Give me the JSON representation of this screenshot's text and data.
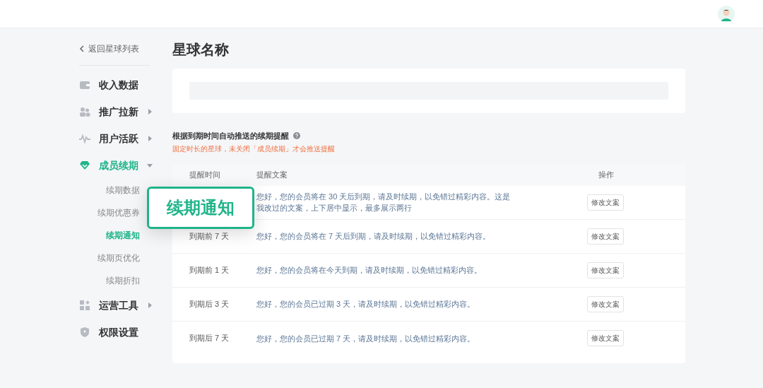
{
  "back_link": "返回星球列表",
  "sidebar": {
    "items": [
      {
        "label": "收入数据",
        "kind": "wallet",
        "selected": false
      },
      {
        "label": "推广拉新",
        "kind": "users",
        "selected": false,
        "expanded": false
      },
      {
        "label": "用户活跃",
        "kind": "pulse",
        "selected": false,
        "expanded": false
      },
      {
        "label": "成员续期",
        "kind": "diamond",
        "selected": true,
        "expanded": true,
        "children": [
          {
            "label": "续期数据",
            "selected": false
          },
          {
            "label": "续期优惠券",
            "selected": false
          },
          {
            "label": "续期通知",
            "selected": true
          },
          {
            "label": "续期页优化",
            "selected": false
          },
          {
            "label": "续期折扣",
            "selected": false
          }
        ]
      },
      {
        "label": "运营工具",
        "kind": "grid",
        "selected": false,
        "expanded": false
      },
      {
        "label": "权限设置",
        "kind": "shield",
        "selected": false
      }
    ]
  },
  "page_title": "星球名称",
  "section": {
    "title": "根据到期时间自动推送的续期提醒",
    "warning": "固定时长的星球，未关闭「成员续期」才会推送提醒"
  },
  "table": {
    "columns": [
      "提醒时间",
      "提醒文案",
      "操作"
    ],
    "rows": [
      {
        "message": "您好，您的会员将在 30 天后到期，请及时续期，以免错过精彩内容。这是我改过的文案，上下居中显示，最多展示两行",
        "action": "修改文案"
      },
      {
        "time": "到期前 7 天",
        "message": "您好，您的会员将在 7 天后到期，请及时续期，以免错过精彩内容。",
        "action": "修改文案"
      },
      {
        "time": "到期前 1 天",
        "message": "您好，您的会员将在今天到期，请及时续期，以免错过精彩内容。",
        "action": "修改文案"
      },
      {
        "time": "到期后 3 天",
        "message": "您好，您的会员已过期 3 天，请及时续期，以免错过精彩内容。",
        "action": "修改文案"
      },
      {
        "time": "到期后 7 天",
        "message": "您好，您的会员已过期 7 天，请及时续期，以免错过精彩内容。",
        "action": "修改文案"
      }
    ]
  },
  "callout": "续期通知"
}
